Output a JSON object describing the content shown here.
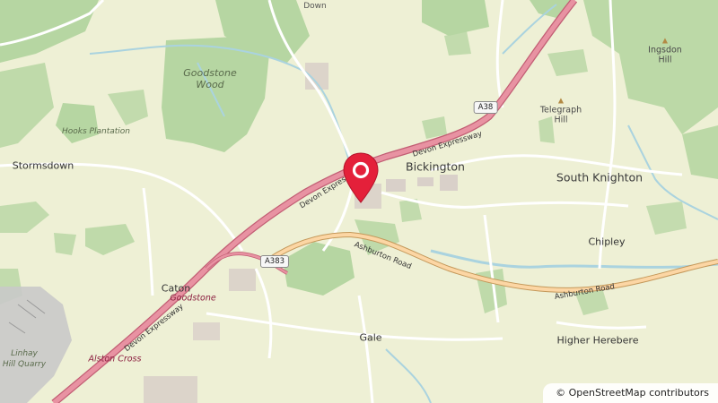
{
  "map": {
    "places": {
      "bickington": "Bickington",
      "south_knighton": "South Knighton",
      "stormsdown": "Stormsdown",
      "caton": "Caton",
      "gale": "Gale",
      "chipley": "Chipley",
      "higher_herebere": "Higher Herebere",
      "down": "Down"
    },
    "woods": {
      "goodstone_wood_line1": "Goodstone",
      "goodstone_wood_line2": "Wood",
      "hooks_plantation": "Hooks Plantation",
      "linhay_line1": "Linhay",
      "linhay_line2": "Hill Quarry"
    },
    "hills": {
      "telegraph_line1": "Telegraph",
      "telegraph_line2": "Hill",
      "ingsdon_line1": "Ingsdon",
      "ingsdon_line2": "Hill"
    },
    "red_labels": {
      "goodstone": "Goodstone",
      "alston_cross": "Alston Cross"
    },
    "roads": {
      "devon_expressway": "Devon Expressway",
      "ashburton_road": "Ashburton Road",
      "a38": "A38",
      "a383": "A383"
    },
    "attribution": "© OpenStreetMap contributors",
    "colors": {
      "background": "#eef0d5",
      "woodland": "#add19e",
      "motorway": "#e892a2",
      "primary_road": "#fcd6a4",
      "water": "#aad3df",
      "marker": "#e4203a"
    }
  }
}
